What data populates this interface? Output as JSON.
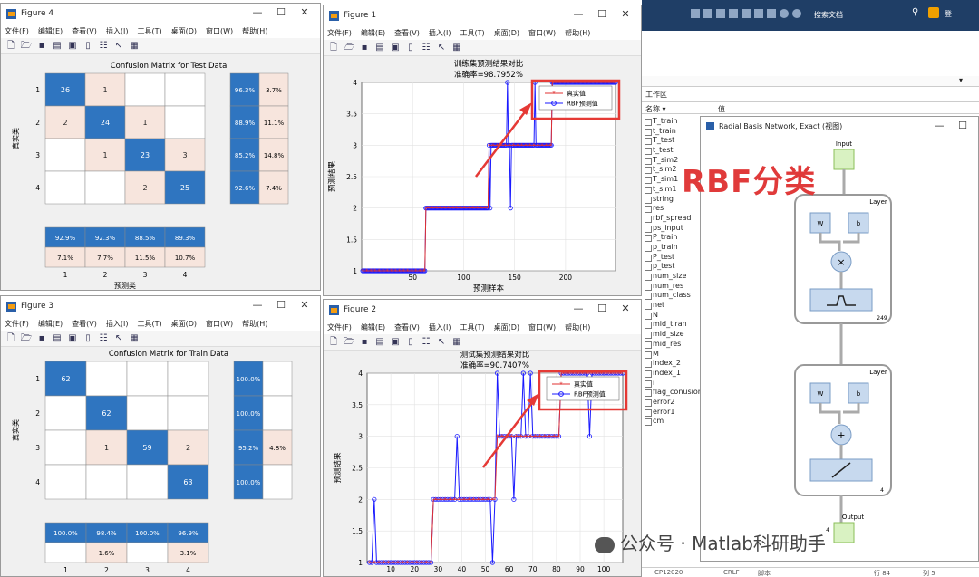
{
  "menu": [
    "文件(F)",
    "编辑(E)",
    "查看(V)",
    "插入(I)",
    "工具(T)",
    "桌面(D)",
    "窗口(W)",
    "帮助(H)"
  ],
  "fig4": {
    "title": "Figure 4",
    "chart_title": "Confusion Matrix for Test Data",
    "ylabel": "真实类",
    "xlabel": "预测类",
    "matrix": [
      [
        26,
        1,
        null,
        null
      ],
      [
        2,
        24,
        1,
        null
      ],
      [
        null,
        1,
        23,
        3
      ],
      [
        null,
        null,
        2,
        25
      ]
    ],
    "row_pct": [
      [
        "96.3%",
        "3.7%"
      ],
      [
        "88.9%",
        "11.1%"
      ],
      [
        "85.2%",
        "14.8%"
      ],
      [
        "92.6%",
        "7.4%"
      ]
    ],
    "col_pct": [
      [
        "92.9%",
        "92.3%",
        "88.5%",
        "89.3%"
      ],
      [
        "7.1%",
        "7.7%",
        "11.5%",
        "10.7%"
      ]
    ],
    "classes": [
      "1",
      "2",
      "3",
      "4"
    ]
  },
  "fig3": {
    "title": "Figure 3",
    "chart_title": "Confusion Matrix for Train Data",
    "ylabel": "真实类",
    "xlabel": "预测类",
    "matrix": [
      [
        62,
        null,
        null,
        null
      ],
      [
        null,
        62,
        null,
        null
      ],
      [
        null,
        1,
        59,
        2
      ],
      [
        null,
        null,
        null,
        63
      ]
    ],
    "row_pct": [
      [
        "100.0%",
        ""
      ],
      [
        "100.0%",
        ""
      ],
      [
        "95.2%",
        "4.8%"
      ],
      [
        "100.0%",
        ""
      ]
    ],
    "col_pct": [
      [
        "100.0%",
        "98.4%",
        "100.0%",
        "96.9%"
      ],
      [
        "",
        "1.6%",
        "",
        "3.1%"
      ]
    ],
    "classes": [
      "1",
      "2",
      "3",
      "4"
    ]
  },
  "fig1": {
    "title": "Figure 1",
    "chart_title": "训练集预测结果对比",
    "subtitle": "准确率=98.7952%",
    "ylabel": "预测结果",
    "xlabel": "预测样本",
    "legend": [
      "真实值",
      "RBF预测值"
    ],
    "xticks": [
      "50",
      "100",
      "150",
      "200"
    ],
    "yticks": [
      "1",
      "1.5",
      "2",
      "2.5",
      "3",
      "3.5",
      "4"
    ]
  },
  "fig2": {
    "title": "Figure 2",
    "chart_title": "测试集预测结果对比",
    "subtitle": "准确率=90.7407%",
    "ylabel": "预测结果",
    "legend": [
      "真实值",
      "RBF预测值"
    ],
    "xticks": [
      "10",
      "20",
      "30",
      "40",
      "50",
      "60",
      "70",
      "80",
      "90",
      "100"
    ],
    "yticks": [
      "1",
      "1.5",
      "2",
      "2.5",
      "3",
      "3.5",
      "4"
    ]
  },
  "chart_data": [
    {
      "type": "line",
      "title": "训练集预测结果对比",
      "subtitle": "准确率=98.7952%",
      "xlabel": "预测样本",
      "ylabel": "预测结果",
      "xlim": [
        0,
        249
      ],
      "ylim": [
        1,
        4
      ],
      "series": [
        {
          "name": "真实值",
          "segments": [
            [
              1,
              62,
              1
            ],
            [
              63,
              124,
              2
            ],
            [
              125,
              186,
              3
            ],
            [
              187,
              249,
              4
            ]
          ]
        },
        {
          "name": "RBF预测值",
          "outliers": [
            [
              126,
              2
            ],
            [
              143,
              4
            ],
            [
              146,
              2
            ],
            [
              170,
              4
            ]
          ]
        }
      ]
    },
    {
      "type": "line",
      "title": "测试集预测结果对比",
      "subtitle": "准确率=90.7407%",
      "ylabel": "预测结果",
      "xlim": [
        0,
        108
      ],
      "ylim": [
        1,
        4
      ],
      "series": [
        {
          "name": "真实值",
          "segments": [
            [
              1,
              27,
              1
            ],
            [
              28,
              54,
              2
            ],
            [
              55,
              81,
              3
            ],
            [
              82,
              108,
              4
            ]
          ]
        },
        {
          "name": "RBF预测值",
          "outliers": [
            [
              3,
              2
            ],
            [
              38,
              3
            ],
            [
              53,
              1
            ],
            [
              55,
              4
            ],
            [
              62,
              2
            ],
            [
              66,
              4
            ],
            [
              69,
              4
            ],
            [
              94,
              3
            ]
          ]
        }
      ]
    }
  ],
  "workspace": {
    "header_col": "工作区",
    "col_name": "名称 ▾",
    "col_value": "值",
    "search": "搜索文档",
    "vars": [
      "T_train",
      "t_train",
      "T_test",
      "t_test",
      "T_sim2",
      "t_sim2",
      "T_sim1",
      "t_sim1",
      "string",
      "res",
      "rbf_spread",
      "ps_input",
      "P_train",
      "p_train",
      "P_test",
      "p_test",
      "num_size",
      "num_res",
      "num_class",
      "net",
      "N",
      "mid_tiran",
      "mid_size",
      "mid_res",
      "M",
      "index_2",
      "index_1",
      "i",
      "flag_conusion",
      "error2",
      "error1",
      "cm"
    ]
  },
  "network": {
    "title": "Radial Basis Network, Exact (视图)",
    "input": "Input",
    "layer": "Layer",
    "w": "W",
    "b": "b",
    "n1": "249",
    "n2": "4",
    "output": "Output",
    "in_num": "4",
    "out_num": "4"
  },
  "overlay": {
    "rbf_label": "RBF分类",
    "watermark": "公众号 · Matlab科研助手"
  },
  "status": [
    "CP12020",
    "CRLF",
    "脚本",
    "行 84",
    "列 5"
  ]
}
